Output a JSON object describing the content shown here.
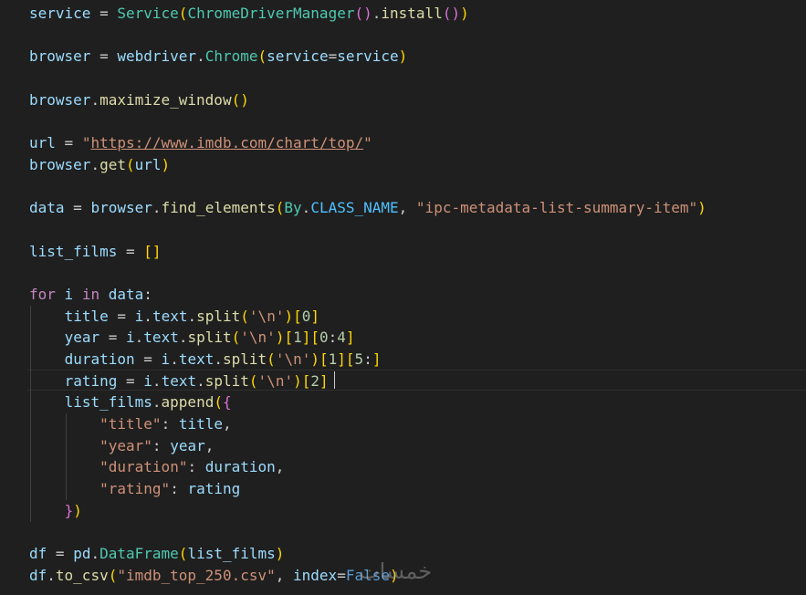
{
  "editor": {
    "theme": "dark",
    "lines": [
      {
        "text": "service = Service(ChromeDriverManager().install())"
      },
      {
        "text": ""
      },
      {
        "text": "browser = webdriver.Chrome(service=service)"
      },
      {
        "text": ""
      },
      {
        "text": "browser.maximize_window()"
      },
      {
        "text": ""
      },
      {
        "text": "url = \"https://www.imdb.com/chart/top/\""
      },
      {
        "text": "browser.get(url)"
      },
      {
        "text": ""
      },
      {
        "text": "data = browser.find_elements(By.CLASS_NAME, \"ipc-metadata-list-summary-item\")"
      },
      {
        "text": ""
      },
      {
        "text": "list_films = []"
      },
      {
        "text": ""
      },
      {
        "text": "for i in data:"
      },
      {
        "text": "    title = i.text.split('\\n')[0]"
      },
      {
        "text": "    year = i.text.split('\\n')[1][0:4]"
      },
      {
        "text": "    duration = i.text.split('\\n')[1][5:]"
      },
      {
        "text": "    rating = i.text.split('\\n')[2]"
      },
      {
        "text": "    list_films.append({"
      },
      {
        "text": "        \"title\": title,"
      },
      {
        "text": "        \"year\": year,"
      },
      {
        "text": "        \"duration\": duration,"
      },
      {
        "text": "        \"rating\": rating"
      },
      {
        "text": "    })"
      },
      {
        "text": ""
      },
      {
        "text": "df = pd.DataFrame(list_films)"
      },
      {
        "text": "df.to_csv(\"imdb_top_250.csv\", index=False)"
      }
    ],
    "cursor_line": 18
  },
  "watermark": {
    "text": "خمسات"
  },
  "colors": {
    "background": "#1f1f1f",
    "variable": "#9cdcfe",
    "class": "#4ec9b0",
    "function": "#dcdcaa",
    "string": "#ce9178",
    "number": "#b5cea8",
    "keyword_control": "#c586c0",
    "keyword": "#569cd6",
    "constant": "#4fc1ff",
    "bracket_level1": "#ffd700",
    "bracket_level2": "#da70d6",
    "bracket_level3": "#179fff"
  }
}
